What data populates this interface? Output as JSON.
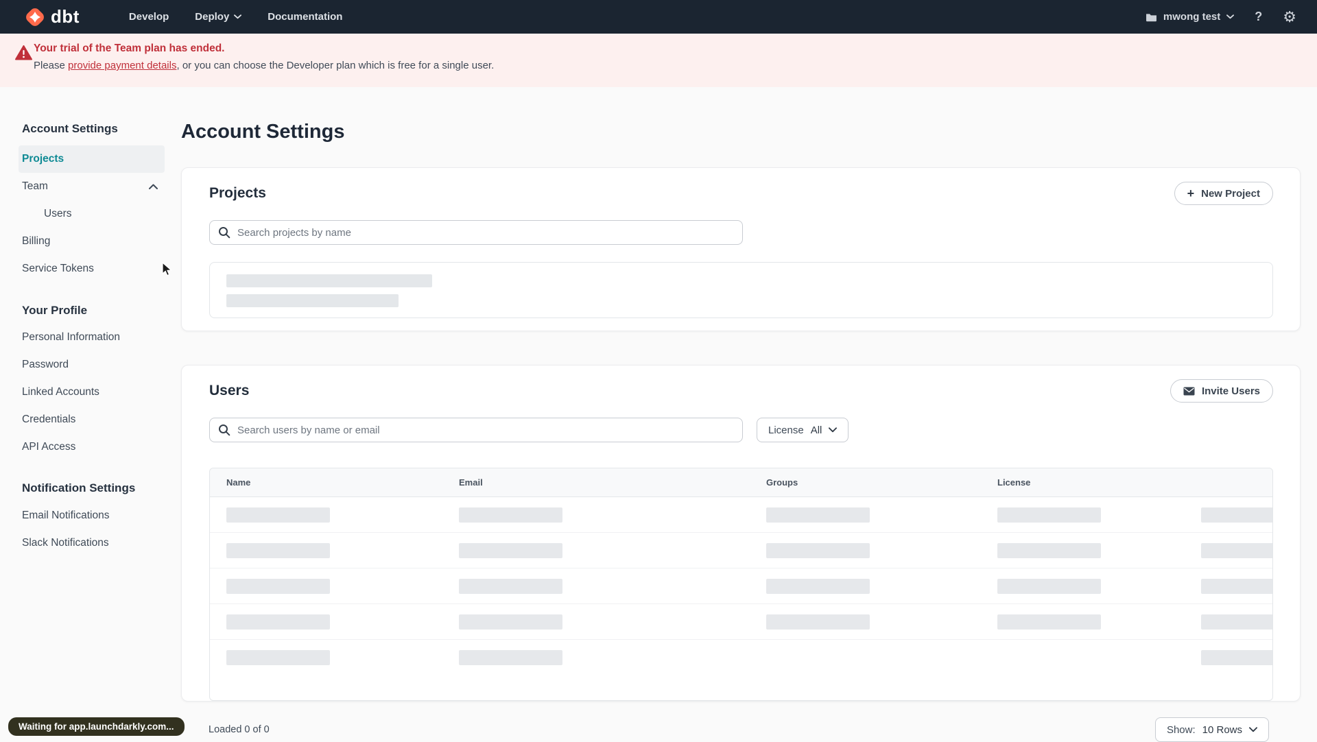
{
  "topnav": {
    "logo_text": "dbt",
    "menu": [
      {
        "label": "Develop"
      },
      {
        "label": "Deploy"
      },
      {
        "label": "Documentation"
      }
    ],
    "account_label": "mwong test",
    "help_glyph": "?",
    "gear_glyph": "⚙"
  },
  "banner": {
    "title": "Your trial of the Team plan has ended.",
    "body_prefix": "Please ",
    "link_text": "provide payment details",
    "body_suffix": ", or you can choose the Developer plan which is free for a single user."
  },
  "sidebar": {
    "sections": [
      {
        "header": "Account Settings",
        "items": [
          {
            "label": "Projects"
          },
          {
            "label": "Team"
          },
          {
            "label": "Users"
          },
          {
            "label": "Billing"
          },
          {
            "label": "Service Tokens"
          }
        ]
      },
      {
        "header": "Your Profile",
        "items": [
          {
            "label": "Personal Information"
          },
          {
            "label": "Password"
          },
          {
            "label": "Linked Accounts"
          },
          {
            "label": "Credentials"
          },
          {
            "label": "API Access"
          }
        ]
      },
      {
        "header": "Notification Settings",
        "items": [
          {
            "label": "Email Notifications"
          },
          {
            "label": "Slack Notifications"
          }
        ]
      }
    ],
    "active_item": "Projects"
  },
  "page": {
    "title": "Account Settings"
  },
  "projects_card": {
    "title": "Projects",
    "new_project_button": "New Project",
    "plus_glyph": "+",
    "search_placeholder": "Search projects by name"
  },
  "users_card": {
    "title": "Users",
    "invite_button": "Invite Users",
    "search_placeholder": "Search users by name or email",
    "license_filter_label": "License",
    "license_filter_value": "All",
    "table_headers": [
      "Name",
      "Email",
      "Groups",
      "License"
    ],
    "skeleton_row_count": 5,
    "loaded_text": "Loaded 0 of 0",
    "show_label": "Show:",
    "show_value": "10 Rows"
  },
  "status_bubble": "Waiting for app.launchdarkly.com...",
  "colors": {
    "nav_bg": "#1b2531",
    "brand_orange": "#ff6a4b",
    "accent_teal": "#0e8a94",
    "banner_bg": "#fdf0ef",
    "alert_red": "#c0303a"
  }
}
